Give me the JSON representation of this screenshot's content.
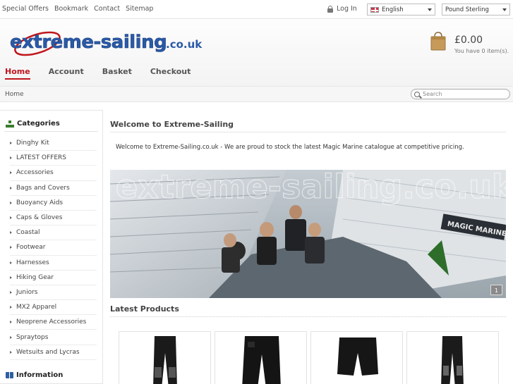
{
  "topbar": {
    "links": [
      "Special Offers",
      "Bookmark",
      "Contact",
      "Sitemap"
    ],
    "login_label": "Log In",
    "language": "English",
    "currency": "Pound Sterling"
  },
  "header": {
    "logo_text": "extreme-sailing.co.uk",
    "cart_total": "£0.00",
    "cart_items": "You have 0 item(s)."
  },
  "nav": {
    "items": [
      "Home",
      "Account",
      "Basket",
      "Checkout"
    ],
    "active": "Home"
  },
  "breadcrumb": "Home",
  "search": {
    "placeholder": "Search"
  },
  "sidebar": {
    "categories_title": "Categories",
    "categories": [
      "Dinghy Kit",
      "LATEST OFFERS",
      "Accessories",
      "Bags and Covers",
      "Buoyancy Aids",
      "Caps & Gloves",
      "Coastal",
      "Footwear",
      "Harnesses",
      "Hiking Gear",
      "Juniors",
      "MX2 Apparel",
      "Neoprene Accessories",
      "Spraytops",
      "Wetsuits and Lycras"
    ],
    "information_title": "Information"
  },
  "main": {
    "welcome_title": "Welcome to Extreme-Sailing",
    "intro": "Welcome to Extreme-Sailing.co.uk - We are proud to stock the latest Magic Marine catalogue at competitive pricing.",
    "banner_watermark": "extreme-sailing.co.uk",
    "banner_sail_text": "MAGIC MARINE",
    "slide_number": "1",
    "latest_title": "Latest Products"
  },
  "colors": {
    "accent": "#c0161d",
    "logo_blue": "#2a5aa8",
    "category_icon": "#3a7d2c",
    "info_icon": "#2e5fa0"
  }
}
